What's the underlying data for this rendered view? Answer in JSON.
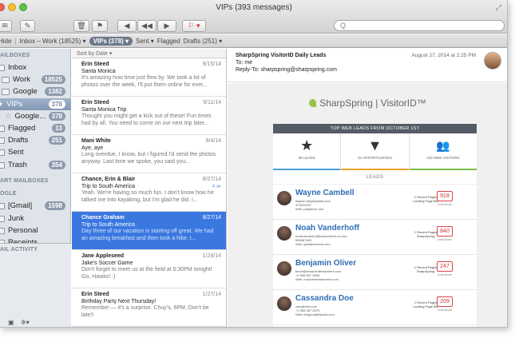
{
  "window": {
    "title": "VIPs (393 messages)"
  },
  "toolbar": {
    "get_mail_label": "✉",
    "compose_label": "✎",
    "delete_label": "🗑",
    "junk_label": "⚑",
    "reply_label": "◀",
    "reply_all_label": "◀◀",
    "forward_label": "▶",
    "flag_label": "⚐ ▾",
    "search_placeholder": "Q"
  },
  "favbar": {
    "hide": "Hide",
    "inbox": "Inbox – Work (18525) ▾",
    "vips": "VIPs (378) ▾",
    "sent": "Sent ▾",
    "flagged": "Flagged",
    "drafts": "Drafts (251) ▾"
  },
  "sidebar": {
    "mailboxes_header": "AILBOXES",
    "items": [
      {
        "label": "Inbox",
        "count": ""
      },
      {
        "label": "Work",
        "count": "18525"
      },
      {
        "label": "Google",
        "count": "1382"
      },
      {
        "label": "VIPs",
        "count": "378"
      },
      {
        "label": "Google...",
        "count": "378"
      },
      {
        "label": "Flagged",
        "count": "13"
      },
      {
        "label": "Drafts",
        "count": "251"
      },
      {
        "label": "Sent",
        "count": ""
      },
      {
        "label": "Trash",
        "count": "354"
      }
    ],
    "smart_header": "ART MAILBOXES",
    "google_header": "OGLE",
    "google_items": [
      {
        "label": "[Gmail]",
        "count": "1598"
      },
      {
        "label": "Junk",
        "count": ""
      },
      {
        "label": "Personal",
        "count": ""
      },
      {
        "label": "Receipts",
        "count": ""
      }
    ],
    "activity_header": "AIL ACTIVITY"
  },
  "list": {
    "sort_label": "Sort by Date ▾",
    "messages": [
      {
        "from": "Erin Steed",
        "date": "9/15/14",
        "subject": "Santa Monica",
        "preview": "It's amazing how time just flew by. We took a lot of photos over the week, I'll put them online for ever..."
      },
      {
        "from": "Erin Steed",
        "date": "9/11/14",
        "subject": "Santa Monica Trip",
        "preview": "Thought you might get a kick out of these! Fun times had by all. You need to come on our next trip later..."
      },
      {
        "from": "Mani White",
        "date": "9/4/14",
        "subject": "Aye, aye",
        "preview": "Long overdue, I know, but I figured I'd send the photos anyway. Last time we spoke, you said you..."
      },
      {
        "from": "Chance, Erin & Blair",
        "date": "8/27/14",
        "subject": "Trip to South America",
        "preview": "Yeah. We're having so much fun. I don't know how he talked me into kayaking, but I'm glad he did. I...",
        "tag": "4 ≫"
      },
      {
        "from": "Chance Graham",
        "date": "8/27/14",
        "subject": "Trip to South America",
        "preview": "Day three of our vacation is starting off great. We had an amazing breakfast and then took a hike. I..."
      },
      {
        "from": "Jane Appleseed",
        "date": "1/28/14",
        "subject": "Jake's Soccer Game",
        "preview": "Don't forget to meet us at the field at 5:30PM tonight! Go, Hawks! :)"
      },
      {
        "from": "Erin Steed",
        "date": "1/27/14",
        "subject": "Birthday Party Next Thursday!",
        "preview": "Remember — it's a surprise. Chuy's, 6PM. Don't be late!!"
      }
    ]
  },
  "reader": {
    "subject": "SharpSpring VisitorID Daily Leads",
    "to": "To:  me",
    "reply_to": "Reply-To:  sharpspring@sharpspring.com",
    "date": "August 27, 2014 at 2:25 PM",
    "brand": "SharpSpring | VisitorID™",
    "banner": "TOP WEB LEADS FROM OCTOBER 1ST",
    "stats": [
      {
        "icon": "★",
        "label": "38 LEADS",
        "color": "#4a9fd8"
      },
      {
        "icon": "▼",
        "label": "32 OPPORTUNITIES",
        "color": "#f0a030"
      },
      {
        "icon": "👥",
        "label": "233 WEB VISITORS",
        "color": "#7bbf4a"
      }
    ],
    "leads_header": "LEADS",
    "leads": [
      {
        "name": "Wayne Cambell",
        "email": "wayne.c@partytime.com",
        "phone": "374222647",
        "web": "Web: partytime.com",
        "pages": "1 Recent Pages\nLanding Page Bio",
        "score": "918",
        "score_label": "Lead Score"
      },
      {
        "name": "Noah Vanderhoff",
        "email": "noahvanderhoff@vanderhoff.co.com",
        "phone": "555987483",
        "web": "Web: globalnetwork.com",
        "pages": "1 Recent Pages\nSharpSpring",
        "score": "840",
        "score_label": "Lead Score"
      },
      {
        "name": "Benjamin Oliver",
        "email": "benol@musicentertainment.com",
        "phone": "+1 555 557 0839",
        "web": "Web: musicentertainment.com",
        "pages": "1 Recent Pages\nSharpSpring",
        "score": "247",
        "score_label": "Lead Score"
      },
      {
        "name": "Cassandra Doe",
        "email": "cam@ehd.com",
        "phone": "+1 555 557 2879",
        "web": "Web: thegoodpetstand.com",
        "pages": "1 Recent Pages\nLanding Page Bio",
        "score": "209",
        "score_label": "Lead Score"
      }
    ]
  },
  "colors": {
    "accent": "#3a78e0",
    "sidebar_sel": "#8397b4",
    "link": "#2f6db5",
    "score": "#cc3333"
  }
}
